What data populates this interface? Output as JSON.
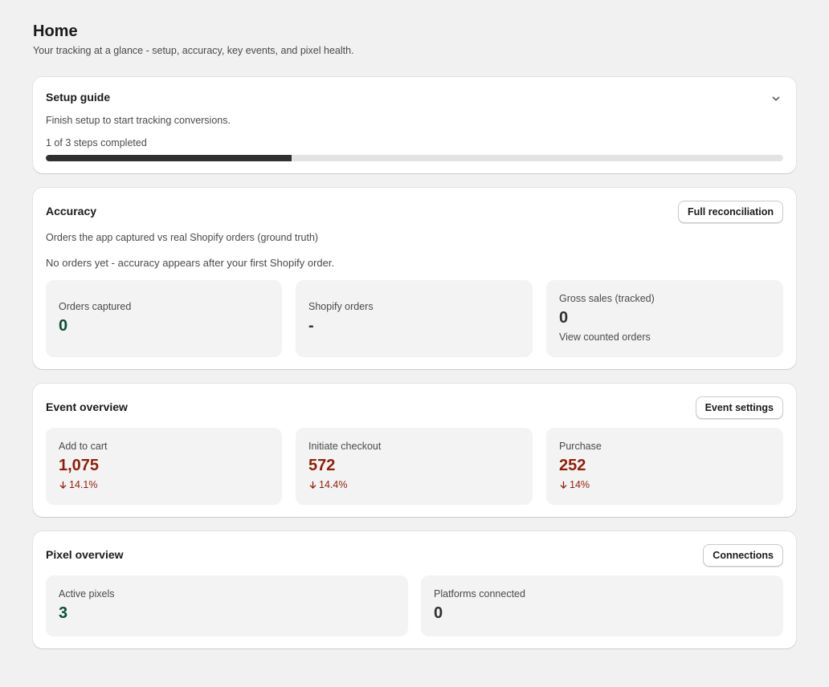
{
  "header": {
    "title": "Home",
    "subtitle": "Your tracking at a glance - setup, accuracy, key events, and pixel health."
  },
  "setup_guide": {
    "title": "Setup guide",
    "description": "Finish setup to start tracking conversions.",
    "progress_text": "1 of 3 steps completed",
    "steps_completed": 1,
    "steps_total": 3,
    "toggle_icon": "chevron-down-icon"
  },
  "accuracy": {
    "title": "Accuracy",
    "button_label": "Full reconciliation",
    "description": "Orders the app captured vs real Shopify orders (ground truth)",
    "notice": "No orders yet - accuracy appears after your first Shopify order.",
    "stats": [
      {
        "label": "Orders captured",
        "value": "0"
      },
      {
        "label": "Shopify orders",
        "value": "-"
      },
      {
        "label": "Gross sales (tracked)",
        "value": "0",
        "link": "View counted orders"
      }
    ]
  },
  "event_overview": {
    "title": "Event overview",
    "button_label": "Event settings",
    "stats": [
      {
        "label": "Add to cart",
        "value": "1,075",
        "change": "14.1%",
        "change_icon": "arrow-down-icon"
      },
      {
        "label": "Initiate checkout",
        "value": "572",
        "change": "14.4%",
        "change_icon": "arrow-down-icon"
      },
      {
        "label": "Purchase",
        "value": "252",
        "change": "14%",
        "change_icon": "arrow-down-icon"
      }
    ]
  },
  "pixel_overview": {
    "title": "Pixel overview",
    "button_label": "Connections",
    "stats": [
      {
        "label": "Active pixels",
        "value": "3"
      },
      {
        "label": "Platforms connected",
        "value": "0"
      }
    ]
  },
  "colors": {
    "page_background": "#f1f1f1",
    "card_background": "#ffffff",
    "stat_background": "#f3f3f3",
    "positive_value": "#0c5132",
    "negative_value": "#8e1f0b",
    "progress_fill": "#303030",
    "progress_track": "#e3e3e3"
  }
}
